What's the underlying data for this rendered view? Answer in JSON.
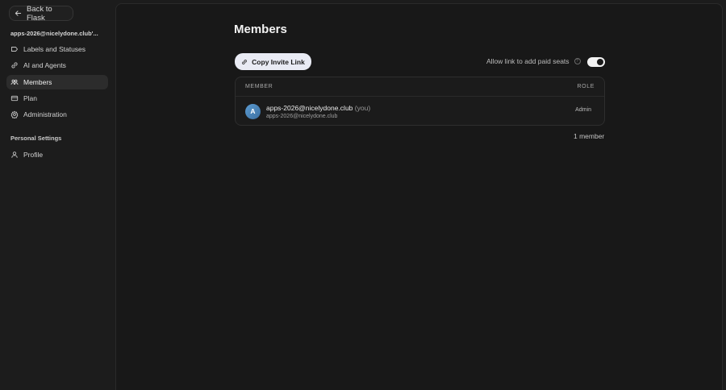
{
  "sidebar": {
    "back_label": "Back to Flask",
    "workspace": "apps-2026@nicelydone.club'...",
    "items": [
      {
        "label": "Labels and Statuses",
        "icon": "tag-icon"
      },
      {
        "label": "AI and Agents",
        "icon": "link-icon"
      },
      {
        "label": "Members",
        "icon": "members-icon",
        "active": true
      },
      {
        "label": "Plan",
        "icon": "card-icon"
      },
      {
        "label": "Administration",
        "icon": "gear-icon"
      }
    ],
    "personal_label": "Personal Settings",
    "personal_items": [
      {
        "label": "Profile",
        "icon": "user-icon"
      }
    ]
  },
  "main": {
    "title": "Members",
    "copy_invite_label": "Copy Invite Link",
    "allow_label": "Allow link to add paid seats",
    "help_glyph": "?",
    "toggle_on": true,
    "table": {
      "col_member": "MEMBER",
      "col_role": "ROLE",
      "rows": [
        {
          "avatar_letter": "A",
          "name": "apps-2026@nicelydone.club",
          "you_tag": "(you)",
          "email": "apps-2026@nicelydone.club",
          "role": "Admin"
        }
      ]
    },
    "member_count": "1 member"
  },
  "colors": {
    "background": "#1c1c1c",
    "panel": "#181818",
    "button_light": "#e9ebf4",
    "avatar": "#4a86bd"
  }
}
